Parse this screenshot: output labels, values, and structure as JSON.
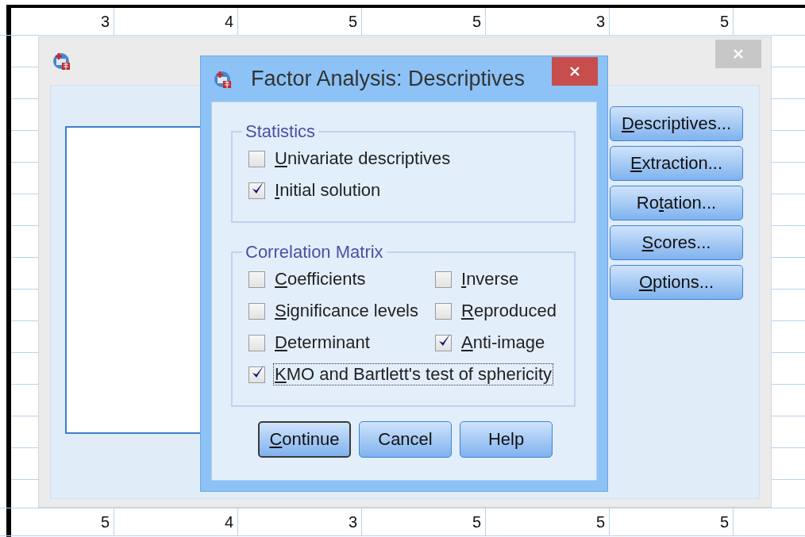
{
  "spreadsheet": {
    "top_row": [
      "3",
      "4",
      "5",
      "5",
      "3",
      "5"
    ],
    "bottom_row": [
      "5",
      "4",
      "3",
      "5",
      "5",
      "5"
    ]
  },
  "main_window": {
    "buttons": [
      {
        "label": [
          {
            "text": "D",
            "underlined": true
          },
          {
            "text": "escriptives...",
            "underlined": false
          }
        ]
      },
      {
        "label": [
          {
            "text": "E",
            "underlined": true
          },
          {
            "text": "xtraction...",
            "underlined": false
          }
        ]
      },
      {
        "label": [
          {
            "text": "Ro",
            "underlined": false
          },
          {
            "text": "t",
            "underlined": true
          },
          {
            "text": "ation...",
            "underlined": false
          }
        ]
      },
      {
        "label": [
          {
            "text": "S",
            "underlined": true
          },
          {
            "text": "cores...",
            "underlined": false
          }
        ]
      },
      {
        "label": [
          {
            "text": "O",
            "underlined": true
          },
          {
            "text": "ptions...",
            "underlined": false
          }
        ]
      }
    ]
  },
  "dialog": {
    "title": "Factor Analysis: Descriptives",
    "groups": [
      {
        "title": "Statistics",
        "rows": [
          [
            {
              "label": [
                {
                  "text": "U",
                  "underlined": true
                },
                {
                  "text": "nivariate descriptives",
                  "underlined": false
                }
              ],
              "checked": false,
              "focused": false
            }
          ],
          [
            {
              "label": [
                {
                  "text": "I",
                  "underlined": true
                },
                {
                  "text": "nitial solution",
                  "underlined": false
                }
              ],
              "checked": true,
              "focused": false
            }
          ]
        ]
      },
      {
        "title": "Correlation Matrix",
        "rows": [
          [
            {
              "label": [
                {
                  "text": "C",
                  "underlined": true
                },
                {
                  "text": "oefficients",
                  "underlined": false
                }
              ],
              "checked": false,
              "focused": false
            },
            {
              "label": [
                {
                  "text": "I",
                  "underlined": true
                },
                {
                  "text": "nverse",
                  "underlined": false
                }
              ],
              "checked": false,
              "focused": false
            }
          ],
          [
            {
              "label": [
                {
                  "text": "S",
                  "underlined": true
                },
                {
                  "text": "ignificance levels",
                  "underlined": false
                }
              ],
              "checked": false,
              "focused": false
            },
            {
              "label": [
                {
                  "text": "R",
                  "underlined": true
                },
                {
                  "text": "eproduced",
                  "underlined": false
                }
              ],
              "checked": false,
              "focused": false
            }
          ],
          [
            {
              "label": [
                {
                  "text": "D",
                  "underlined": true
                },
                {
                  "text": "eterminant",
                  "underlined": false
                }
              ],
              "checked": false,
              "focused": false
            },
            {
              "label": [
                {
                  "text": "A",
                  "underlined": true
                },
                {
                  "text": "nti-image",
                  "underlined": false
                }
              ],
              "checked": true,
              "focused": false
            }
          ],
          [
            {
              "label": [
                {
                  "text": "K",
                  "underlined": true
                },
                {
                  "text": "MO and Bartlett's test of sphericity",
                  "underlined": false
                }
              ],
              "checked": true,
              "focused": true
            }
          ]
        ]
      }
    ],
    "buttons": [
      {
        "label": [
          {
            "text": "C",
            "underlined": true
          },
          {
            "text": "ontinue",
            "underlined": false
          }
        ],
        "default": true
      },
      {
        "label": [
          {
            "text": "Cancel",
            "underlined": false
          }
        ],
        "default": false
      },
      {
        "label": [
          {
            "text": "Help",
            "underlined": false
          }
        ],
        "default": false
      }
    ]
  }
}
